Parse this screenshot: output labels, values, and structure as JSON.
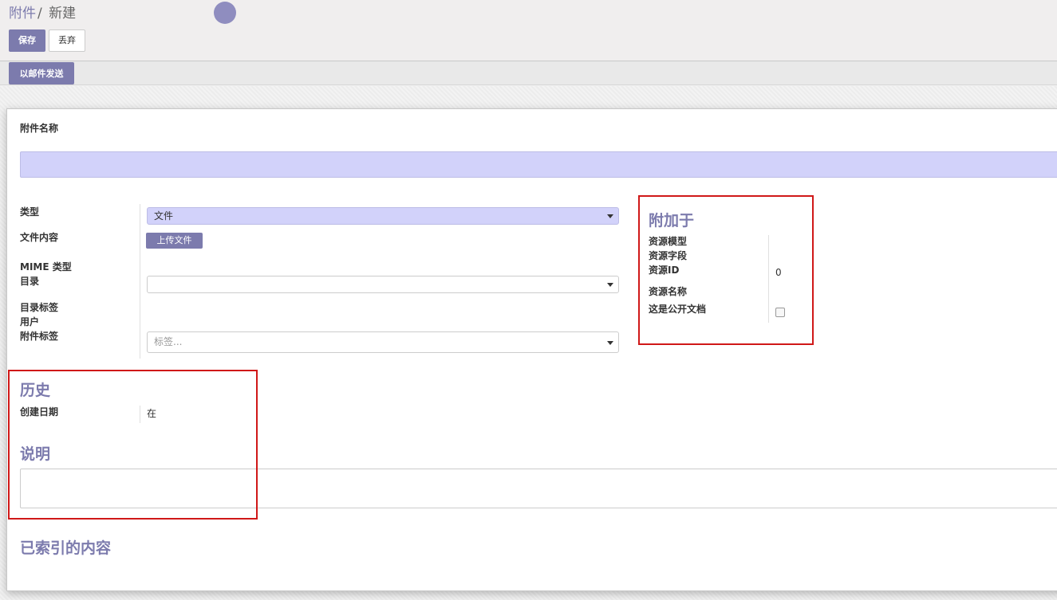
{
  "breadcrumb": {
    "parent": "附件",
    "separator": "/",
    "current": "新建"
  },
  "toolbar": {
    "save_label": "保存",
    "discard_label": "丢弃"
  },
  "statusbar": {
    "send_mail_label": "以邮件发送"
  },
  "form": {
    "name_label": "附件名称",
    "name_value": "",
    "type_label": "类型",
    "type_value": "文件",
    "file_content_label": "文件内容",
    "upload_label": "上传文件",
    "mime_label": "MIME 类型",
    "directory_label": "目录",
    "directory_value": "",
    "directory_tags_label": "目录标签",
    "user_label": "用户",
    "attachment_tags_label": "附件标签",
    "tags_placeholder": "标签..."
  },
  "attached_to": {
    "title": "附加于",
    "res_model_label": "资源模型",
    "res_field_label": "资源字段",
    "res_id_label": "资源ID",
    "res_id_value": "0",
    "res_name_label": "资源名称",
    "public_label": "这是公开文档",
    "public_checked": false
  },
  "history": {
    "title": "历史",
    "create_date_label": "创建日期",
    "create_date_value": "在"
  },
  "description": {
    "title": "说明",
    "value": ""
  },
  "indexed": {
    "title": "已索引的内容"
  },
  "colors": {
    "brand": "#7c7bad",
    "required_field": "#d2d2fa",
    "highlight_box": "#d01818"
  }
}
